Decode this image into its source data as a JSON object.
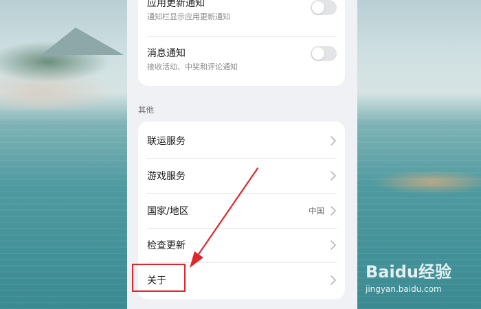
{
  "notifications": {
    "app_update": {
      "title": "应用更新通知",
      "subtitle": "通知栏显示应用更新通知",
      "enabled": false
    },
    "messages": {
      "title": "消息通知",
      "subtitle": "接收活动、中奖和评论通知",
      "enabled": false
    }
  },
  "others": {
    "section_title": "其他",
    "items": [
      {
        "label": "联运服务",
        "value": "",
        "icon": "chevron-right-icon"
      },
      {
        "label": "游戏服务",
        "value": "",
        "icon": "chevron-right-icon"
      },
      {
        "label": "国家/地区",
        "value": "中国",
        "icon": "chevron-right-icon"
      },
      {
        "label": "检查更新",
        "value": "",
        "icon": "chevron-right-icon"
      },
      {
        "label": "关于",
        "value": "",
        "icon": "chevron-right-icon"
      }
    ]
  },
  "annotation": {
    "highlight_color": "#e0262b",
    "arrow_color": "#e0262b"
  },
  "watermark": {
    "brand": "Baidu经验",
    "url": "jingyan.baidu.com"
  }
}
